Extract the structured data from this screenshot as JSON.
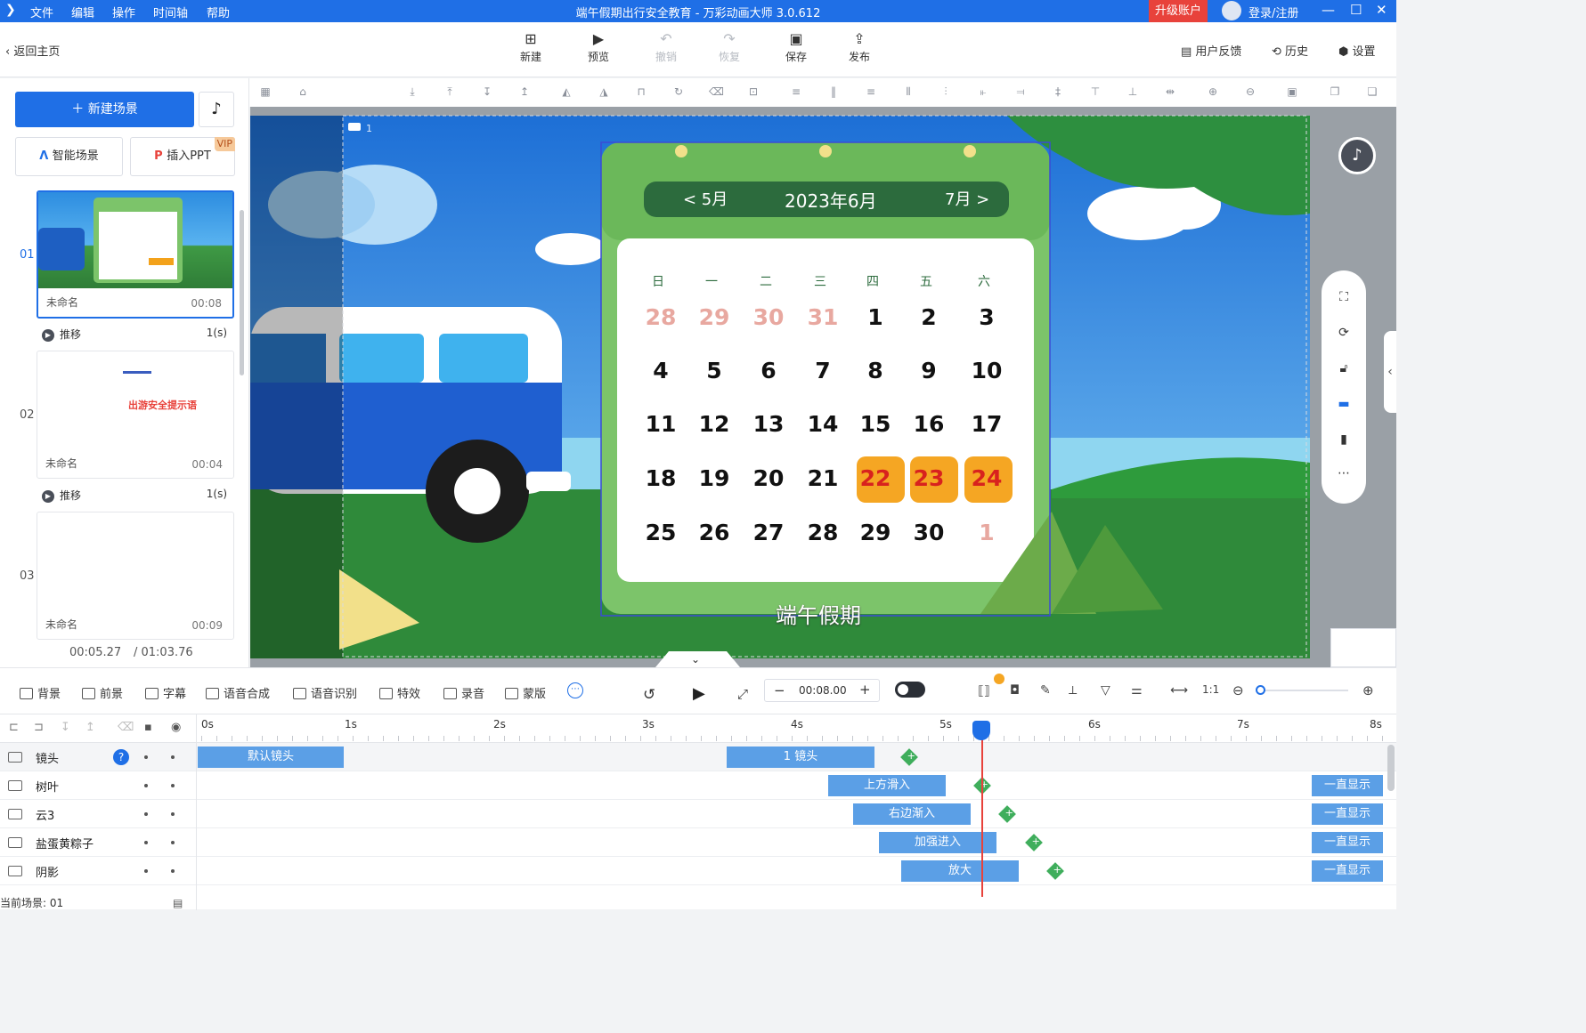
{
  "titlebar": {
    "menus": [
      "文件",
      "编辑",
      "操作",
      "时间轴",
      "帮助"
    ],
    "title": "端午假期出行安全教育 - 万彩动画大师 3.0.612",
    "upgrade": "升级账户",
    "login": "登录/注册"
  },
  "toolbar": {
    "back": "返回主页",
    "buttons": {
      "new": "新建",
      "preview": "预览",
      "undo": "撤销",
      "redo": "恢复",
      "save": "保存",
      "publish": "发布"
    },
    "right": {
      "feedback": "用户反馈",
      "history": "历史",
      "settings": "设置"
    }
  },
  "left": {
    "new_scene": "新建场景",
    "smart_scene": "智能场景",
    "insert_ppt": "插入PPT",
    "vip": "VIP",
    "scenes": [
      {
        "no": "01",
        "name": "未命名",
        "duration": "00:08",
        "transition": "推移",
        "trans_time": "1(s)"
      },
      {
        "no": "02",
        "name": "未命名",
        "duration": "00:04",
        "transition": "推移",
        "trans_time": "1(s)",
        "thumb_text": "出游安全提示语"
      },
      {
        "no": "03",
        "name": "未命名",
        "duration": "00:09"
      }
    ],
    "current_time": "00:05.27",
    "total_time": "/ 01:03.76"
  },
  "canvas": {
    "camera_label": "1",
    "calendar": {
      "prev": "< 5月",
      "month": "2023年6月",
      "next": "7月 >",
      "weekdays": [
        "日",
        "一",
        "二",
        "三",
        "四",
        "五",
        "六"
      ],
      "rows": [
        [
          "28",
          "29",
          "30",
          "31",
          "1",
          "2",
          "3"
        ],
        [
          "4",
          "5",
          "6",
          "7",
          "8",
          "9",
          "10"
        ],
        [
          "11",
          "12",
          "13",
          "14",
          "15",
          "16",
          "17"
        ],
        [
          "18",
          "19",
          "20",
          "21",
          "22",
          "23",
          "24"
        ],
        [
          "25",
          "26",
          "27",
          "28",
          "29",
          "30",
          "1"
        ]
      ],
      "caption": "端午假期"
    }
  },
  "timeline_tools": {
    "items": [
      "背景",
      "前景",
      "字幕",
      "语音合成",
      "语音识别",
      "特效",
      "录音",
      "蒙版"
    ],
    "time_value": "00:08.00"
  },
  "timeline": {
    "ruler": [
      "0s",
      "1s",
      "2s",
      "3s",
      "4s",
      "5s",
      "6s",
      "7s",
      "8s"
    ],
    "tracks": [
      {
        "name": "镜头",
        "clips": [
          "默认镜头",
          "1 镜头"
        ]
      },
      {
        "name": "树叶",
        "clips": [
          "上方滑入",
          "一直显示"
        ]
      },
      {
        "name": "云3",
        "clips": [
          "右边渐入",
          "一直显示"
        ]
      },
      {
        "name": "盐蛋黄粽子",
        "clips": [
          "加强进入",
          "一直显示"
        ]
      },
      {
        "name": "阴影",
        "clips": [
          "放大",
          "一直显示"
        ]
      }
    ],
    "current_scene": "当前场景: 01"
  }
}
